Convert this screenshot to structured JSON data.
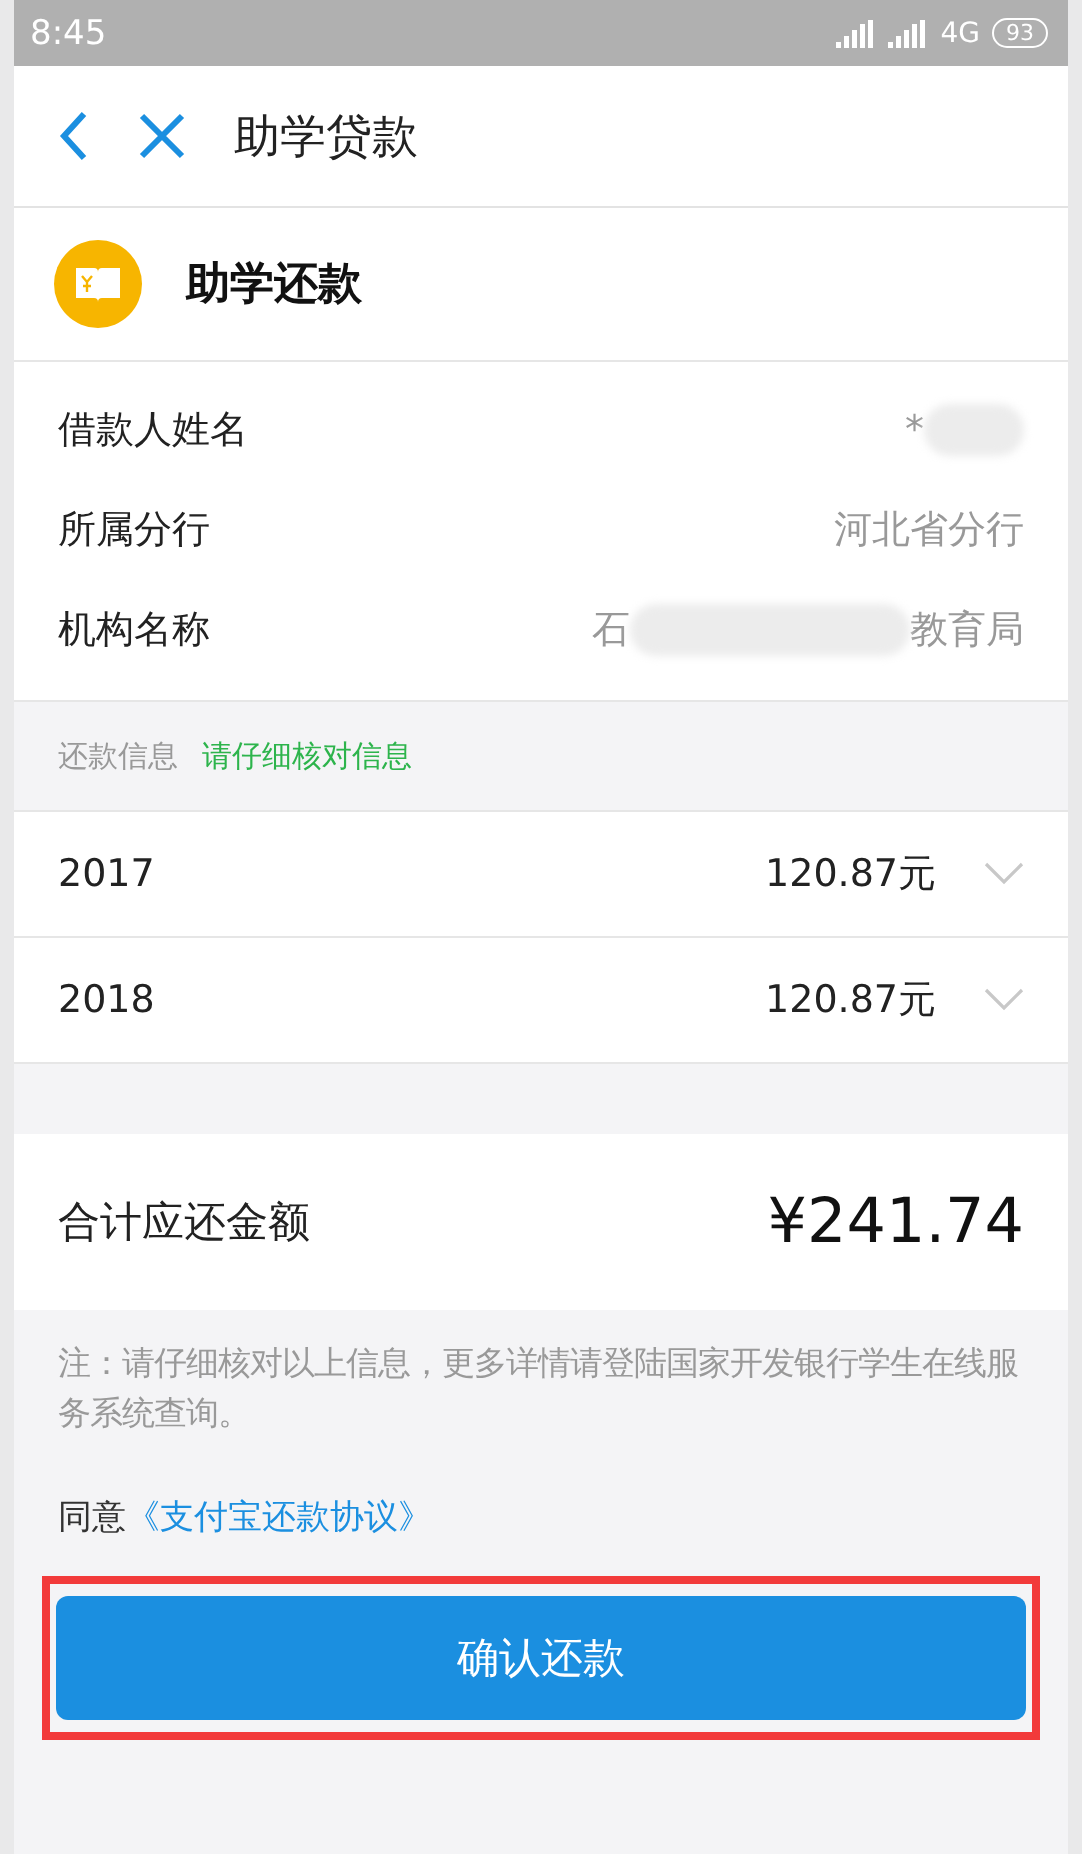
{
  "status_bar": {
    "time": "8:45",
    "network": "4G",
    "battery": "93"
  },
  "header": {
    "title": "助学贷款"
  },
  "card": {
    "title": "助学还款"
  },
  "info_rows": [
    {
      "label": "借款人姓名",
      "value_parts": [
        "*"
      ],
      "redacted": true
    },
    {
      "label": "所属分行",
      "value_parts": [
        "河北省分行"
      ],
      "redacted": false
    },
    {
      "label": "机构名称",
      "value_parts": [
        "石",
        "教育局"
      ],
      "redacted": true
    }
  ],
  "repayment_section": {
    "label": "还款信息",
    "hint": "请仔细核对信息"
  },
  "repayments": [
    {
      "year": "2017",
      "amount": "120.87元",
      "expanded": false
    },
    {
      "year": "2018",
      "amount": "120.87元",
      "expanded": false
    }
  ],
  "total": {
    "label": "合计应还金额",
    "amount": "¥241.74"
  },
  "note": "注：请仔细核对以上信息，更多详情请登陆国家开发银行学生在线服务系统查询。",
  "agreement": {
    "prefix": "同意",
    "link": "《支付宝还款协议》"
  },
  "confirm_button": {
    "label": "确认还款",
    "highlighted": true
  }
}
